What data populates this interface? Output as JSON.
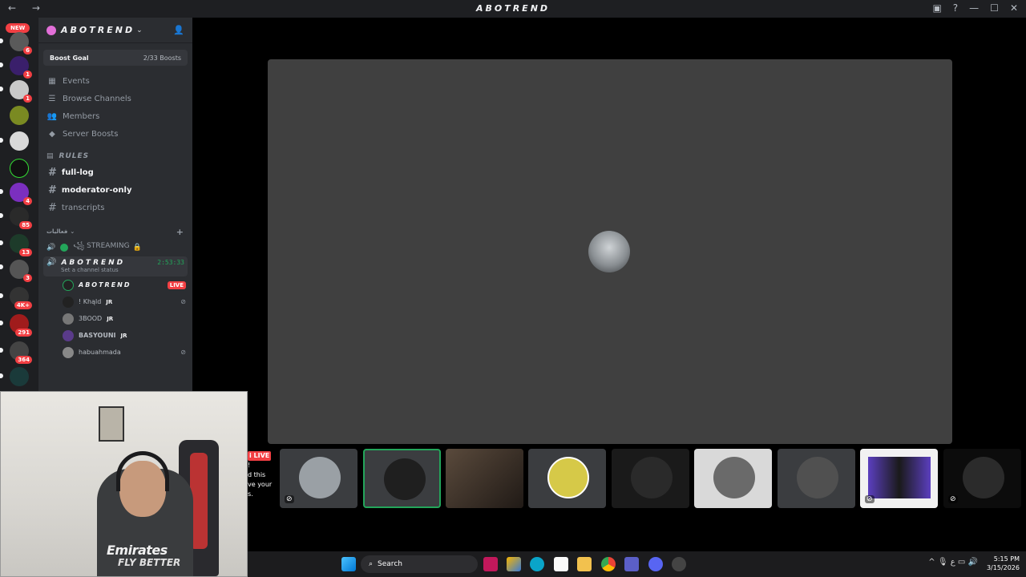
{
  "window": {
    "title": "ABOTREND",
    "nav": "← →",
    "controls": [
      "▣",
      "?",
      "—",
      "☐",
      "✕"
    ]
  },
  "guilds": {
    "new_label": "NEW",
    "items": [
      {
        "badge": "6"
      },
      {
        "badge": "1"
      },
      {
        "badge": "1"
      },
      {
        "badge": ""
      },
      {
        "badge": ""
      },
      {
        "badge": ""
      },
      {
        "badge": "4"
      },
      {
        "badge": "85"
      },
      {
        "badge": "13"
      },
      {
        "badge": "3"
      },
      {
        "badge": "4K+"
      },
      {
        "badge": "291"
      },
      {
        "badge": "364"
      },
      {
        "badge": ""
      }
    ]
  },
  "server": {
    "name": "ABOTREND",
    "boost_goal_label": "Boost Goal",
    "boost_count": "2/33 Boosts",
    "menu": [
      {
        "label": "Events",
        "icon": "calendar-icon"
      },
      {
        "label": "Browse Channels",
        "icon": "browse-icon"
      },
      {
        "label": "Members",
        "icon": "members-icon"
      },
      {
        "label": "Server Boosts",
        "icon": "boost-icon"
      }
    ],
    "category_rules": "RULES",
    "channels": [
      {
        "label": "full-log",
        "unread": true
      },
      {
        "label": "moderator-only",
        "unread": true
      },
      {
        "label": "transcripts",
        "unread": false
      }
    ],
    "category_voice": "فعاليات",
    "voice_streaming": "꧁ STREAMING",
    "voice_active": "ABOTREND",
    "voice_timer": "2:53:33",
    "channel_status": "Set a channel status",
    "users": [
      {
        "name": "ABOTREND",
        "live": "LIVE"
      },
      {
        "name": "! Khąld",
        "tag": "JR"
      },
      {
        "name": "3BOOD",
        "tag": "JR"
      },
      {
        "name": "BASYOUNI",
        "tag": "JR"
      },
      {
        "name": "habuahmada",
        "tag": ""
      }
    ]
  },
  "chat_peek": [
    "i LIVE",
    "!",
    "d this",
    "ve your",
    "s."
  ],
  "webcam": {
    "jersey_line1": "Emirates",
    "jersey_line2": "FLY BETTER"
  },
  "taskbar": {
    "search_placeholder": "Search",
    "time": "5:15 PM",
    "date": "3/15/2026",
    "lang": "ع"
  }
}
